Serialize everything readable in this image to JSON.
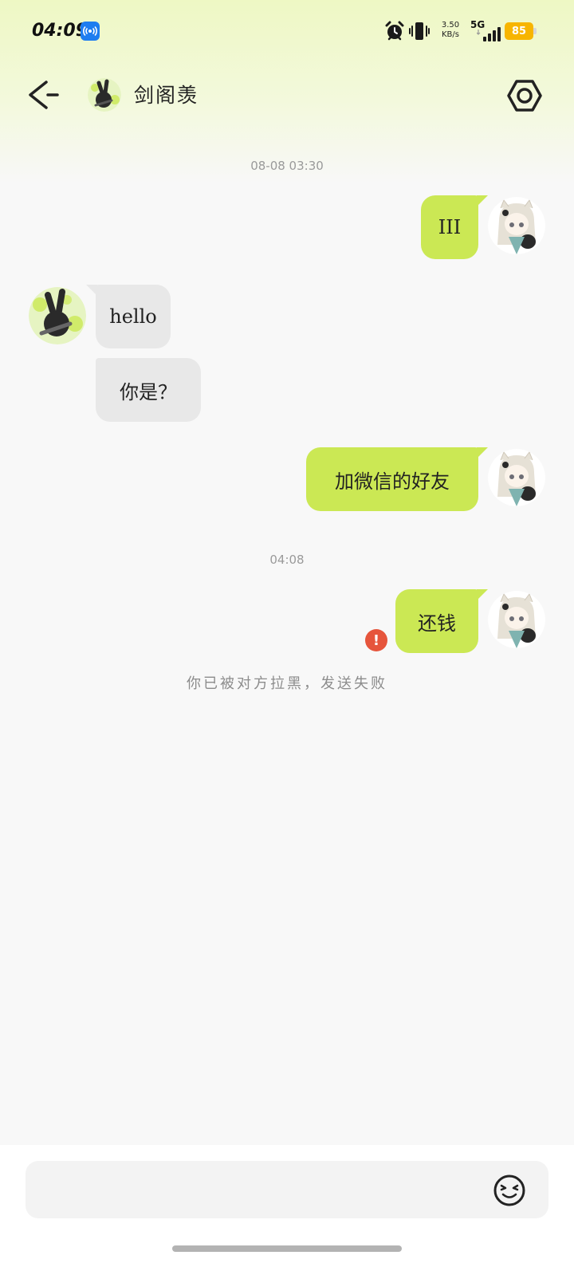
{
  "status_bar": {
    "time": "04:09",
    "net_speed_value": "3.50",
    "net_speed_unit": "KB/s",
    "network": "5G",
    "battery": "85",
    "icons": [
      "hotspot-icon",
      "alarm-icon",
      "vibrate-icon",
      "signal-icon",
      "battery-icon"
    ]
  },
  "header": {
    "contact_name": "剑阁羡",
    "icons": [
      "back-arrow-icon",
      "gear-icon"
    ]
  },
  "conversation": {
    "timestamps": [
      "08-08 03:30",
      "04:08"
    ],
    "messages": [
      {
        "direction": "out",
        "text": "III"
      },
      {
        "direction": "in",
        "text": "hello"
      },
      {
        "direction": "in",
        "text": "你是？"
      },
      {
        "direction": "out",
        "text": "加微信的好友"
      },
      {
        "direction": "out",
        "text": "还钱",
        "status": "failed"
      }
    ],
    "system_notice": "你已被对方拉黑，发送失败",
    "error_mark": "!"
  },
  "input": {
    "placeholder": "",
    "value": "",
    "icons": [
      "emoji-icon"
    ]
  },
  "colors": {
    "outgoing_bubble": "#cbe854",
    "incoming_bubble": "#e8e8e8",
    "error": "#e6553c",
    "battery": "#f7b500",
    "hotspot": "#1e7df0"
  }
}
